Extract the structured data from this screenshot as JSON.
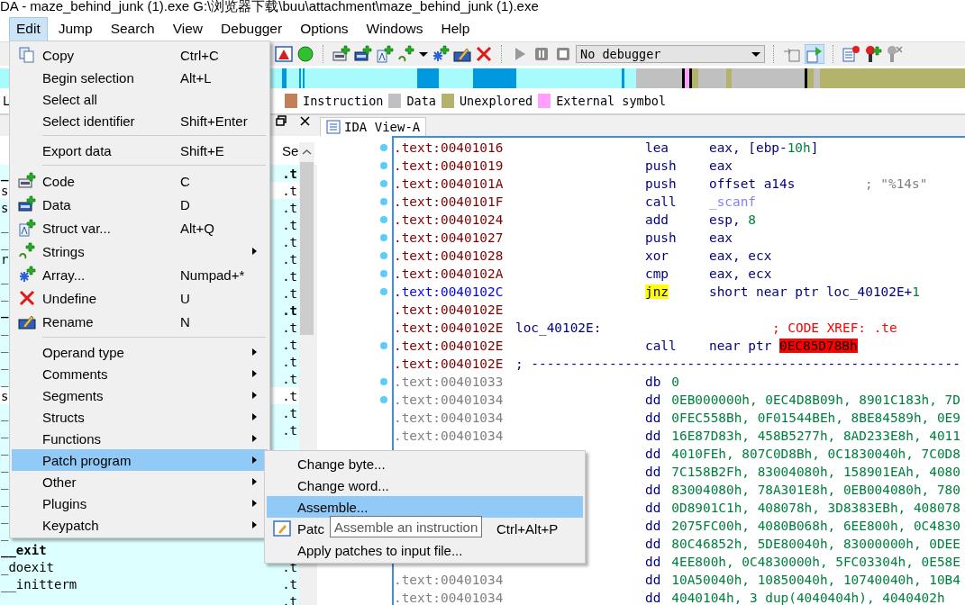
{
  "window": {
    "title": "DA - maze_behind_junk (1).exe G:\\浏览器下载\\buu\\attachment\\maze_behind_junk (1).exe"
  },
  "menubar": [
    {
      "label": "Edit",
      "selected": true
    },
    {
      "label": "Jump",
      "selected": false
    },
    {
      "label": "Search",
      "selected": false
    },
    {
      "label": "View",
      "selected": false
    },
    {
      "label": "Debugger",
      "selected": false
    },
    {
      "label": "Options",
      "selected": false
    },
    {
      "label": "Windows",
      "selected": false
    },
    {
      "label": "Help",
      "selected": false
    }
  ],
  "toolbar": {
    "debugger_select": "No debugger"
  },
  "legend": [
    {
      "label": "L"
    },
    {
      "label": "Instruction",
      "color": "#c0805a"
    },
    {
      "label": "Data",
      "color": "#c0c0c0"
    },
    {
      "label": "Unexplored",
      "color": "#b3b36b"
    },
    {
      "label": "External symbol",
      "color": "#ffa0ff"
    }
  ],
  "functions_panel": {
    "column_header": "Se",
    "rows": [
      {
        "name": "_",
        "segment": ".t",
        "kind": "library",
        "bold": true
      },
      {
        "name": "s",
        "segment": ".t",
        "kind": "regular",
        "bold": false
      },
      {
        "name": "s",
        "segment": ".t",
        "kind": "library",
        "bold": false
      },
      {
        "name": "_",
        "segment": ".t",
        "kind": "library",
        "bold": false
      },
      {
        "name": "_",
        "segment": ".t",
        "kind": "library",
        "bold": false
      },
      {
        "name": "r",
        "segment": ".t",
        "kind": "library",
        "bold": false
      },
      {
        "name": "_",
        "segment": ".t",
        "kind": "library",
        "bold": false
      },
      {
        "name": "_",
        "segment": ".t",
        "kind": "library",
        "bold": false
      },
      {
        "name": "_",
        "segment": ".t",
        "kind": "library",
        "bold": true
      },
      {
        "name": "_",
        "segment": ".t",
        "kind": "library",
        "bold": false
      },
      {
        "name": "_",
        "segment": ".t",
        "kind": "library",
        "bold": false
      },
      {
        "name": "_",
        "segment": ".t",
        "kind": "library",
        "bold": false
      },
      {
        "name": "_",
        "segment": ".t",
        "kind": "library",
        "bold": false
      },
      {
        "name": "s",
        "segment": ".t",
        "kind": "regular",
        "bold": false
      },
      {
        "name": "_",
        "segment": ".t",
        "kind": "library",
        "bold": false
      },
      {
        "name": "_",
        "segment": ".t",
        "kind": "library",
        "bold": false
      },
      {
        "name": "_",
        "kind": "library",
        "bold": false
      },
      {
        "name": "_",
        "kind": "library",
        "bold": false
      },
      {
        "name": "_",
        "kind": "library",
        "bold": false
      },
      {
        "name": "_",
        "kind": "library",
        "bold": false
      },
      {
        "name": "_",
        "kind": "library",
        "bold": false
      },
      {
        "name": "_",
        "kind": "library",
        "bold": false
      },
      {
        "name": "__exit",
        "kind": "library",
        "bold": true
      },
      {
        "name": "_doexit",
        "segment": ".t",
        "kind": "library",
        "bold": false
      },
      {
        "name": "__initterm",
        "segment": ".t",
        "kind": "library",
        "bold": false
      },
      {
        "segment": ".t",
        "kind": "library",
        "bold": false
      }
    ]
  },
  "ida_view": {
    "tab": "IDA View-A",
    "lines": [
      {
        "kind": "instruction",
        "addr": ".text:00401016",
        "color": "#800000",
        "dot": true,
        "mnemonic": "lea",
        "highlighted": false,
        "operands": [
          {
            "text": "eax, [ebp-",
            "kind": "text"
          },
          {
            "text": "10h",
            "kind": "num"
          },
          {
            "text": "]",
            "kind": "text"
          }
        ]
      },
      {
        "kind": "instruction",
        "addr": ".text:00401019",
        "color": "#800000",
        "dot": true,
        "mnemonic": "push",
        "highlighted": false,
        "operands": [
          {
            "text": "eax",
            "kind": "text"
          }
        ]
      },
      {
        "kind": "instruction",
        "addr": ".text:0040101A",
        "color": "#800000",
        "dot": true,
        "mnemonic": "push",
        "highlighted": false,
        "operands": [
          {
            "text": "offset a14s",
            "kind": "text"
          }
        ],
        "comment": "; \"%14s\""
      },
      {
        "kind": "instruction",
        "addr": ".text:0040101F",
        "color": "#800000",
        "dot": true,
        "mnemonic": "call",
        "highlighted": false,
        "operands": [
          {
            "text": "_scanf",
            "kind": "import"
          }
        ]
      },
      {
        "kind": "instruction",
        "addr": ".text:00401024",
        "color": "#800000",
        "dot": true,
        "mnemonic": "add",
        "highlighted": false,
        "operands": [
          {
            "text": "esp, ",
            "kind": "text"
          },
          {
            "text": "8",
            "kind": "num"
          }
        ]
      },
      {
        "kind": "instruction",
        "addr": ".text:00401027",
        "color": "#800000",
        "dot": true,
        "mnemonic": "push",
        "highlighted": false,
        "operands": [
          {
            "text": "eax",
            "kind": "text"
          }
        ]
      },
      {
        "kind": "instruction",
        "addr": ".text:00401028",
        "color": "#800000",
        "dot": true,
        "mnemonic": "xor",
        "highlighted": false,
        "operands": [
          {
            "text": "eax, ecx",
            "kind": "text"
          }
        ]
      },
      {
        "kind": "instruction",
        "addr": ".text:0040102A",
        "color": "#800000",
        "dot": true,
        "mnemonic": "cmp",
        "highlighted": false,
        "operands": [
          {
            "text": "eax, ecx",
            "kind": "text"
          }
        ]
      },
      {
        "kind": "instruction",
        "addr": ".text:0040102C",
        "color": "#0000ff",
        "dot": true,
        "mnemonic": "jnz",
        "highlighted": true,
        "operands": [
          {
            "text": "short near ptr loc_40102E+",
            "kind": "text"
          },
          {
            "text": "1",
            "kind": "num"
          }
        ]
      },
      {
        "kind": "instruction",
        "addr": ".text:0040102E",
        "color": "#800000",
        "dot": false
      },
      {
        "kind": "label",
        "addr": ".text:0040102E",
        "color": "#800000",
        "dot": false,
        "label": "loc_40102E:",
        "comment": "; CODE XREF: .te"
      },
      {
        "kind": "instruction",
        "addr": ".text:0040102E",
        "color": "#800000",
        "dot": true,
        "mnemonic": "call",
        "highlighted": false,
        "operands": [
          {
            "text": "near ptr ",
            "kind": "text"
          },
          {
            "text": "0EC85D78Bh",
            "kind": "error"
          }
        ]
      },
      {
        "kind": "separator",
        "addr": ".text:0040102E",
        "color": "#800000",
        "dot": false,
        "label": "; -------------------------------------------------------"
      },
      {
        "kind": "data",
        "addr": ".text:00401033",
        "color": "#808080",
        "dot": true,
        "mnemonic": "db",
        "highlighted": false,
        "operands": [
          {
            "text": "0",
            "kind": "num"
          }
        ]
      },
      {
        "kind": "data",
        "addr": ".text:00401034",
        "color": "#808080",
        "dot": true,
        "mnemonic": "dd",
        "highlighted": false,
        "operands": [
          {
            "text": "0EB000000h, 0EC4D8B09h, 8901C183h, 7D",
            "kind": "num"
          }
        ]
      },
      {
        "kind": "data",
        "addr": ".text:00401034",
        "color": "#808080",
        "dot": false,
        "mnemonic": "dd",
        "highlighted": false,
        "operands": [
          {
            "text": "0FEC558Bh, 0F01544BEh, 8BE84589h, 0E9",
            "kind": "num"
          }
        ]
      },
      {
        "kind": "data",
        "addr": ".text:00401034",
        "color": "#808080",
        "dot": false,
        "mnemonic": "dd",
        "highlighted": false,
        "operands": [
          {
            "text": "16E87D83h, 458B5277h, 8AD233E8h, 4011",
            "kind": "num"
          }
        ]
      },
      {
        "kind": "data",
        "mnemonic": "dd",
        "highlighted": false,
        "operands": [
          {
            "text": "4010FEh, 807C0D8Bh, 0C1830040h, 7C0D8",
            "kind": "num"
          }
        ]
      },
      {
        "kind": "data",
        "mnemonic": "dd",
        "highlighted": false,
        "operands": [
          {
            "text": "7C158B2Fh, 83004080h, 158901EAh, 4080",
            "kind": "num"
          }
        ]
      },
      {
        "kind": "data",
        "mnemonic": "dd",
        "highlighted": false,
        "operands": [
          {
            "text": "83004080h, 78A301E8h, 0EB004080h, 780",
            "kind": "num"
          }
        ]
      },
      {
        "kind": "data",
        "mnemonic": "dd",
        "highlighted": false,
        "operands": [
          {
            "text": "0D8901C1h, 408078h, 3D8383EBh, 408078",
            "kind": "num"
          }
        ]
      },
      {
        "kind": "data",
        "mnemonic": "dd",
        "highlighted": false,
        "operands": [
          {
            "text": "2075FC00h, 4080B068h, 6EE800h, 0C4830",
            "kind": "num"
          }
        ]
      },
      {
        "kind": "data",
        "mnemonic": "dd",
        "highlighted": false,
        "operands": [
          {
            "text": "80C46852h, 5DE80040h, 83000000h, 0DEE",
            "kind": "num"
          }
        ]
      },
      {
        "kind": "data",
        "mnemonic": "dd",
        "highlighted": false,
        "operands": [
          {
            "text": "4EE800h, 0C4830000h, 5FC03304h, 0E58E",
            "kind": "num"
          }
        ]
      },
      {
        "kind": "data",
        "addr": ".text:00401034",
        "color": "#808080",
        "dot": false,
        "mnemonic": "dd",
        "highlighted": false,
        "operands": [
          {
            "text": "10A50040h, 10850040h, 10740040h, 10B4",
            "kind": "num"
          }
        ]
      },
      {
        "kind": "data",
        "addr": ".text:00401034",
        "color": "#808080",
        "dot": false,
        "mnemonic": "dd",
        "highlighted": false,
        "operands": [
          {
            "text": "4040104h, 3 dup(4040404h), 4040402h",
            "kind": "num"
          }
        ]
      }
    ]
  },
  "edit_menu": [
    {
      "kind": "item",
      "label": "Copy",
      "shortcut": "Ctrl+C",
      "selected": false
    },
    {
      "kind": "item",
      "label": "Begin selection",
      "shortcut": "Alt+L",
      "selected": false
    },
    {
      "kind": "item",
      "label": "Select all",
      "selected": false
    },
    {
      "kind": "item",
      "label": "Select identifier",
      "shortcut": "Shift+Enter",
      "selected": false
    },
    {
      "kind": "separator"
    },
    {
      "kind": "item",
      "label": "Export data",
      "shortcut": "Shift+E",
      "selected": false
    },
    {
      "kind": "separator"
    },
    {
      "kind": "item",
      "label": "Code",
      "shortcut": "C",
      "selected": false
    },
    {
      "kind": "item",
      "label": "Data",
      "shortcut": "D",
      "selected": false
    },
    {
      "kind": "item",
      "label": "Struct var...",
      "shortcut": "Alt+Q",
      "selected": false
    },
    {
      "kind": "item",
      "label": "Strings",
      "submenu": true,
      "selected": false
    },
    {
      "kind": "item",
      "label": "Array...",
      "shortcut": "Numpad+*",
      "selected": false
    },
    {
      "kind": "item",
      "label": "Undefine",
      "shortcut": "U",
      "selected": false
    },
    {
      "kind": "item",
      "label": "Rename",
      "shortcut": "N",
      "selected": false
    },
    {
      "kind": "separator"
    },
    {
      "kind": "item",
      "label": "Operand type",
      "submenu": true,
      "selected": false
    },
    {
      "kind": "item",
      "label": "Comments",
      "submenu": true,
      "selected": false
    },
    {
      "kind": "item",
      "label": "Segments",
      "submenu": true,
      "selected": false
    },
    {
      "kind": "item",
      "label": "Structs",
      "submenu": true,
      "selected": false
    },
    {
      "kind": "item",
      "label": "Functions",
      "submenu": true,
      "selected": false
    },
    {
      "kind": "item",
      "label": "Patch program",
      "submenu": true,
      "selected": true
    },
    {
      "kind": "item",
      "label": "Other",
      "submenu": true,
      "selected": false
    },
    {
      "kind": "item",
      "label": "Plugins",
      "submenu": true,
      "selected": false
    },
    {
      "kind": "item",
      "label": "Keypatch",
      "submenu": true,
      "selected": false
    }
  ],
  "patch_submenu": [
    {
      "kind": "item",
      "label": "Change byte...",
      "selected": false
    },
    {
      "kind": "item",
      "label": "Change word...",
      "selected": false
    },
    {
      "kind": "item",
      "label": "Assemble...",
      "selected": true
    },
    {
      "kind": "item",
      "label": "Patc",
      "shortcut": "Ctrl+Alt+P",
      "selected": false
    },
    {
      "kind": "item",
      "label": "Apply patches to input file...",
      "selected": false
    }
  ],
  "tooltip": "Assemble an instruction"
}
